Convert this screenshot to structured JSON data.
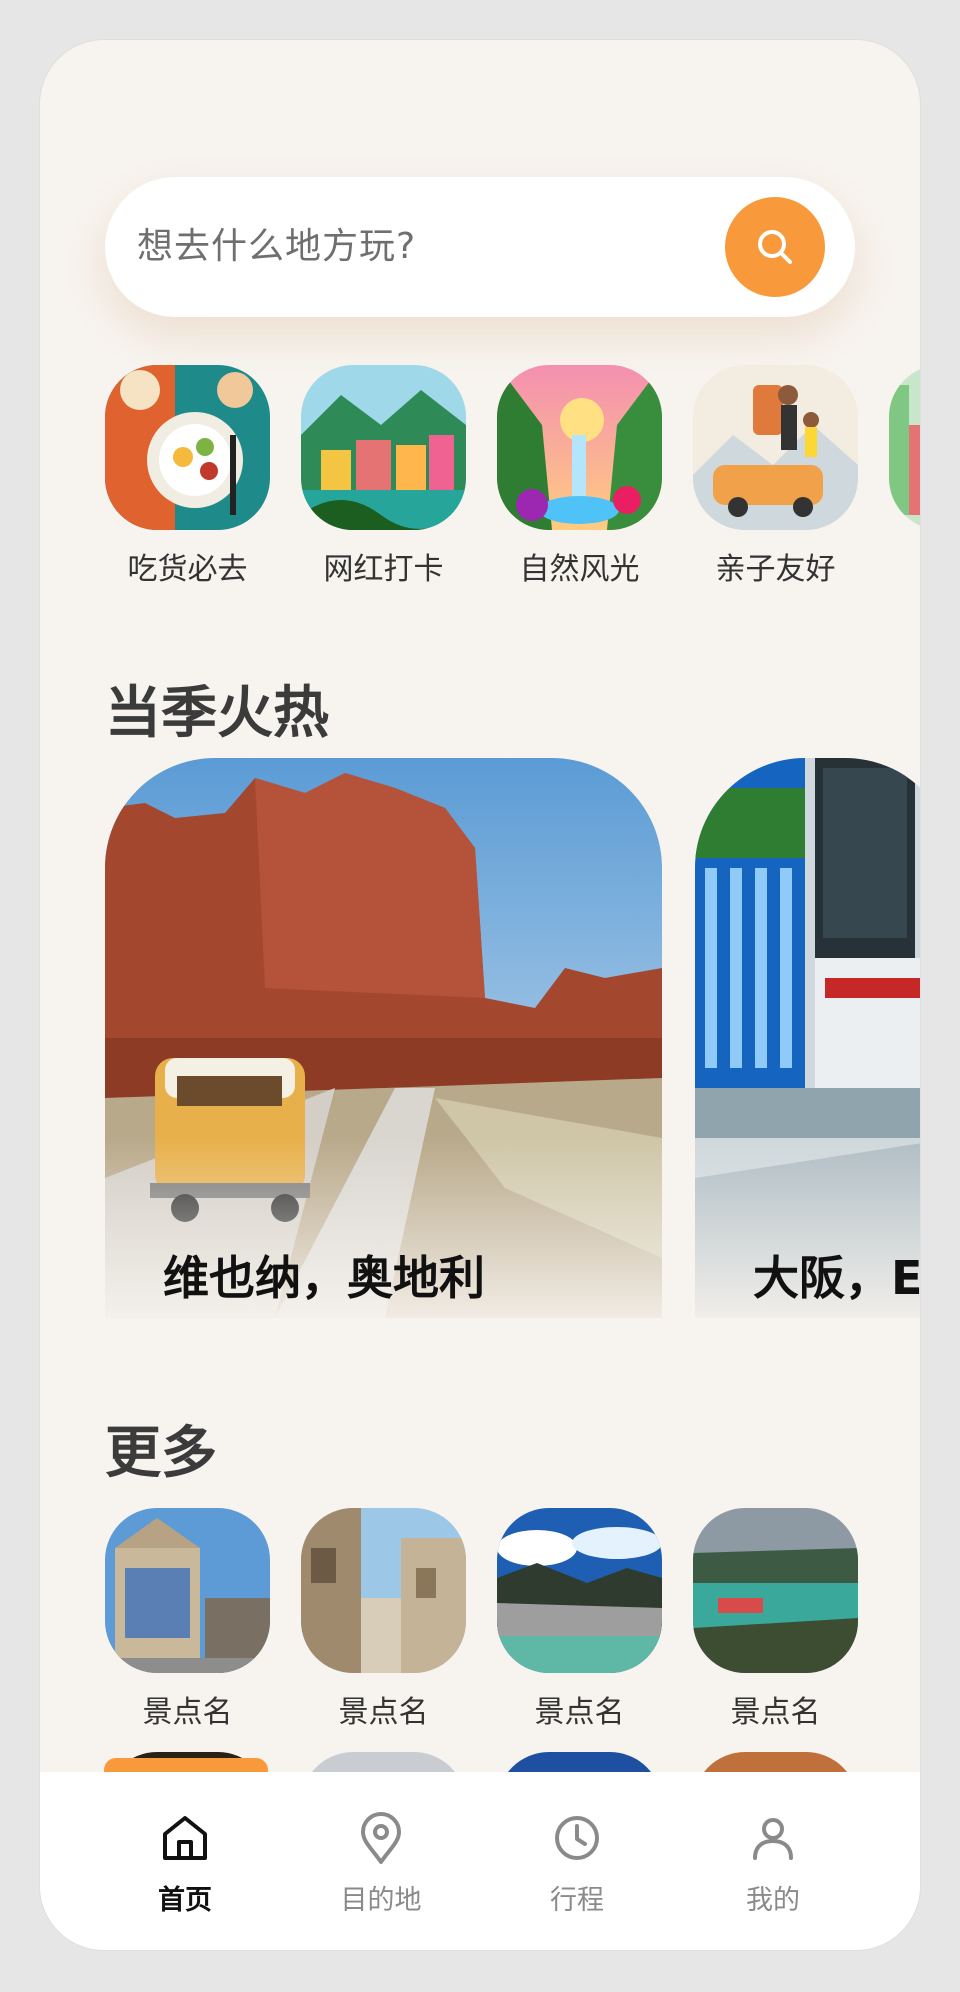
{
  "search": {
    "placeholder": "想去什么地方玩?"
  },
  "categories": [
    {
      "label": "吃货必去",
      "icon": "food-icon"
    },
    {
      "label": "网红打卡",
      "icon": "town-icon"
    },
    {
      "label": "自然风光",
      "icon": "waterfall-icon"
    },
    {
      "label": "亲子友好",
      "icon": "family-icon"
    },
    {
      "label": "",
      "icon": "partial-category-icon"
    }
  ],
  "hot": {
    "title": "当季火热",
    "cards": [
      {
        "title": "维也纳，奥地利"
      },
      {
        "title": "大阪，E"
      }
    ]
  },
  "more": {
    "title": "更多",
    "items": [
      {
        "label": "景点名"
      },
      {
        "label": "景点名"
      },
      {
        "label": "景点名"
      },
      {
        "label": "景点名"
      }
    ]
  },
  "nav": {
    "items": [
      {
        "label": "首页",
        "icon": "home-icon",
        "active": true
      },
      {
        "label": "目的地",
        "icon": "location-pin-icon",
        "active": false
      },
      {
        "label": "行程",
        "icon": "clock-icon",
        "active": false
      },
      {
        "label": "我的",
        "icon": "user-icon",
        "active": false
      }
    ]
  },
  "colors": {
    "accent": "#f89a3c",
    "background": "#f7f3ee",
    "text_dark": "#111111",
    "text_muted": "#8a8a8a"
  }
}
